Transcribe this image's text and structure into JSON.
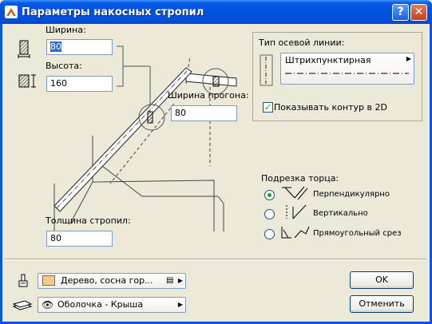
{
  "window": {
    "title": "Параметры накосных стропил",
    "help_label": "?",
    "close_label": "✕"
  },
  "dimensions": {
    "width_label": "Ширина:",
    "width_value": "80",
    "height_label": "Высота:",
    "height_value": "160",
    "purlin_width_label": "Ширина прогона:",
    "purlin_width_value": "80",
    "rafter_thickness_label": "Толщина стропил:",
    "rafter_thickness_value": "80"
  },
  "axis_line": {
    "group_label": "Тип осевой линии:",
    "line_type": "Штрихпунктирная",
    "show_contour_label": "Показывать контур в 2D",
    "show_contour_checked": true
  },
  "end_cut": {
    "label": "Подрезка торца:",
    "options": [
      {
        "label": "Перпендикулярно",
        "selected": true
      },
      {
        "label": "Вертикально",
        "selected": false
      },
      {
        "label": "Прямоугольный срез",
        "selected": false
      }
    ]
  },
  "material": {
    "label": "Дерево, сосна гор...",
    "swatch_color": "#f5c98a"
  },
  "layer": {
    "label": "Оболочка - Крыша"
  },
  "buttons": {
    "ok": "OK",
    "cancel": "Отменить"
  }
}
